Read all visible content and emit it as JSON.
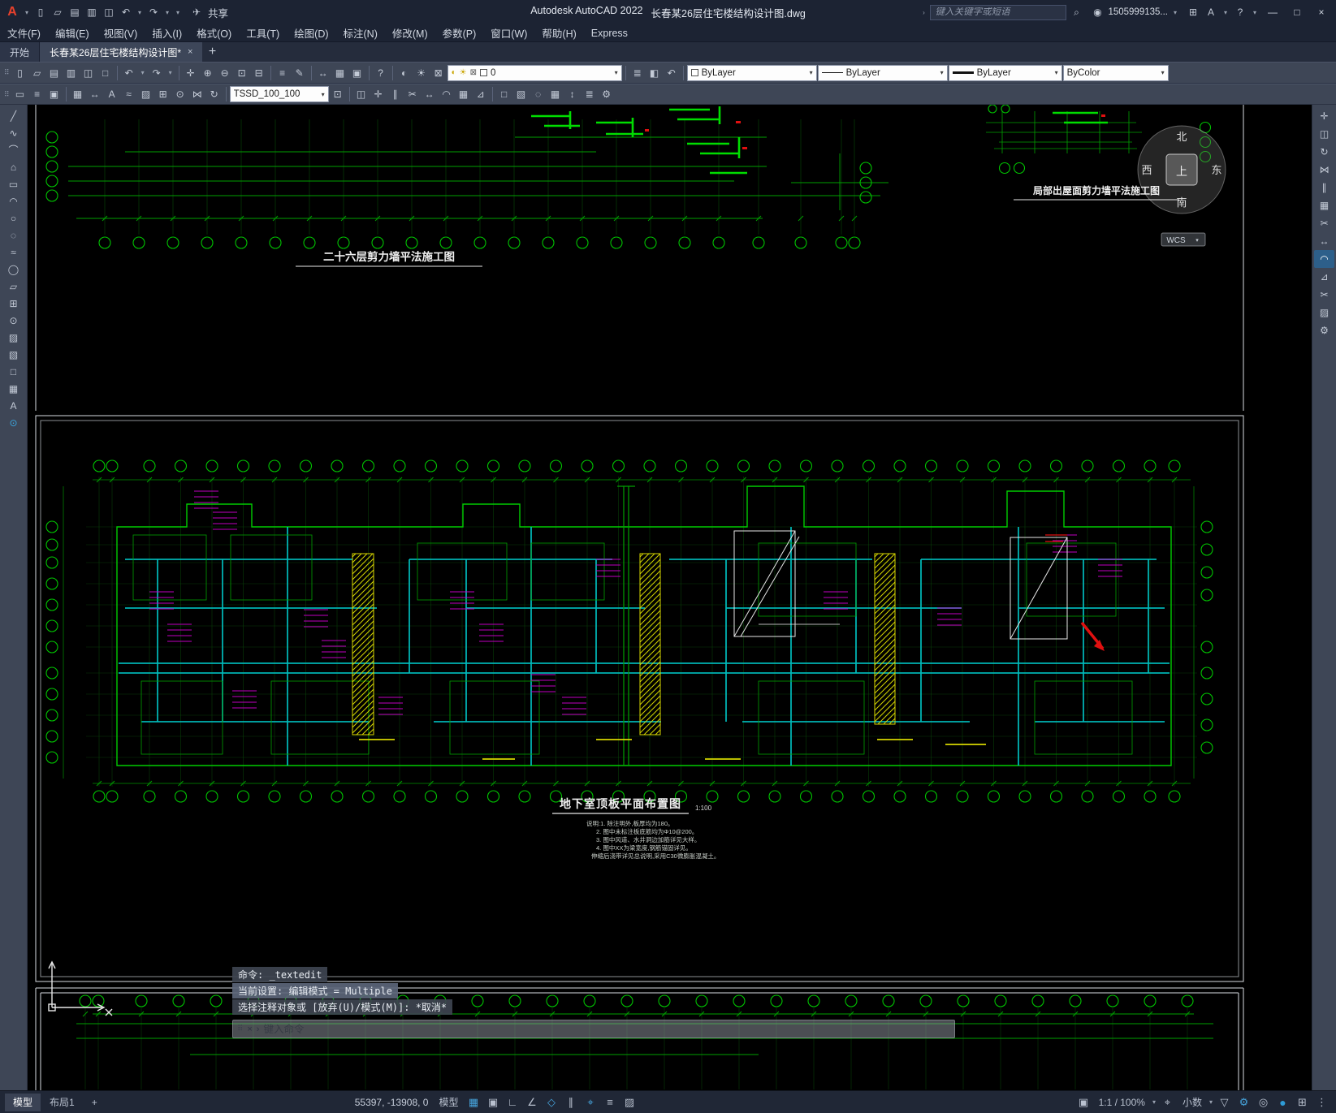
{
  "titlebar": {
    "logo": "A",
    "share_label": "共享",
    "app_title": "Autodesk AutoCAD 2022",
    "doc_title": "长春某26层住宅楼结构设计图.dwg",
    "search_placeholder": "键入关键字或短语",
    "account_id": "1505999135...",
    "window": {
      "minimize": "—",
      "maximize": "□",
      "close": "×"
    }
  },
  "menubar": {
    "items": [
      "文件(F)",
      "编辑(E)",
      "视图(V)",
      "插入(I)",
      "格式(O)",
      "工具(T)",
      "绘图(D)",
      "标注(N)",
      "修改(M)",
      "参数(P)",
      "窗口(W)",
      "帮助(H)",
      "Express"
    ]
  },
  "tabbar": {
    "start_tab": "开始",
    "doc_tab": "长春某26层住宅楼结构设计图*",
    "close": "×",
    "new_tab": "+"
  },
  "toolbar": {
    "layer_value": "0",
    "color_value": "ByLayer",
    "linetype_value": "ByLayer",
    "lineweight_value": "ByLayer",
    "plotstyle_value": "ByColor",
    "tssd_value": "TSSD_100_100"
  },
  "drawing": {
    "title_26f": "二十六层剪力墙平法施工图",
    "title_parapet": "局部出屋面剪力墙平法施工图",
    "title_basement": "地下室顶板平面布置图",
    "basement_scale": "1:100",
    "notes": [
      "说明:1. 除注明外,板厚均为180。",
      "2. 图中未标注板底筋均为Φ10@200。",
      "3. 图中风道、水井洞边加筋详见大样。",
      "4. 图中XX为梁宽度,钢筋锚固详见。",
      "伸缩后浇带详见总说明,采用C30微膨胀混凝土。"
    ],
    "wcs_label": "WCS",
    "compass": {
      "n": "北",
      "s": "南",
      "w": "西",
      "e": "东",
      "up": "上"
    }
  },
  "command": {
    "line1": "命令: _textedit",
    "line2": "当前设置: 编辑模式 = Multiple",
    "line3": "选择注释对象或 [放弃(U)/模式(M)]: *取消*",
    "input_placeholder": "键入命令"
  },
  "statusbar": {
    "model_tab": "模型",
    "layout_tab": "布局1",
    "new_layout": "+",
    "coords": "55397, -13908, 0",
    "model_button": "模型",
    "scale": "1:1 / 100%",
    "units": "小数"
  },
  "colors": {
    "axis_green": "#00c400",
    "wall_cyan": "#00bcbc",
    "text_magenta": "#cc00cc",
    "hatch_yellow": "#d8d800",
    "highlight_red": "#e01010",
    "accent_blue": "#46a3da"
  },
  "icons": {
    "dropdown": "▾",
    "chevron": "›",
    "grip": "⠿",
    "new": "▯",
    "open": "▱",
    "save": "▤",
    "saveas": "▥",
    "plot": "◫",
    "preview": "□",
    "undo": "↶",
    "redo": "↷",
    "share": "✈",
    "search": "⌕",
    "user": "◉",
    "cart": "⊞",
    "help": "?",
    "pan": "✛",
    "zoom_in": "⊕",
    "zoom_out": "⊖",
    "zoom_win": "⊡",
    "zoom_ext": "⊟",
    "props": "≡",
    "match": "✎",
    "measure": "↔",
    "table": "▦",
    "field": "▣",
    "bulb": "◐",
    "sun": "☀",
    "lock": "⊠",
    "layers": "≣",
    "layer_state": "◧",
    "line": "╱",
    "pline": "∿",
    "arc": "⌒",
    "polygon": "⌂",
    "rect": "▭",
    "earc": "◠",
    "circle": "○",
    "cloud": "◌",
    "spline": "≈",
    "ellipse": "◯",
    "insert": "▱",
    "block": "⊞",
    "point": "⊙",
    "hatch": "▨",
    "gradient": "▧",
    "region": "□",
    "mtext": "A",
    "dim": "↕",
    "move": "✛",
    "copy": "◫",
    "rotate": "↻",
    "mirror": "⋈",
    "offset": "∥",
    "array": "▦",
    "trim": "✂",
    "extend": "↔",
    "fillet": "◠",
    "scale": "⊿",
    "erase": "✂",
    "grid": "▦",
    "snap": "▣",
    "ortho": "∟",
    "polar": "∠",
    "osnap": "◇",
    "otrack": "∥",
    "dyn": "⌖",
    "lwt": "≡",
    "transp": "▨",
    "gear": "⚙",
    "filter": "▽",
    "isolate": "◎",
    "circle_dot": "●",
    "clean": "⊞",
    "dots": "⋮"
  }
}
